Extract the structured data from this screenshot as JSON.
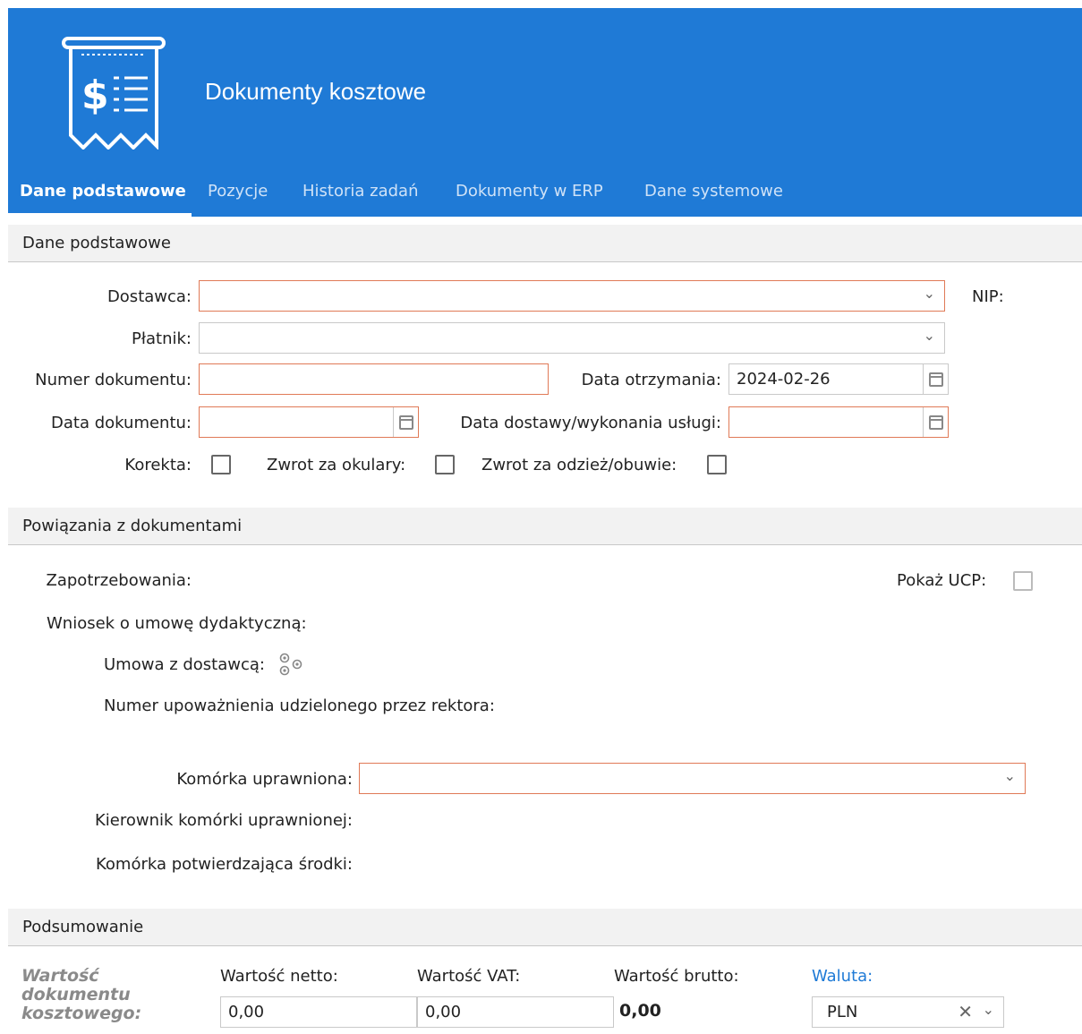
{
  "header": {
    "title": "Dokumenty kosztowe",
    "logo_icon": "receipt-dollar-icon",
    "bg_color": "#1f7ad6"
  },
  "tabs": [
    {
      "label": "Dane podstawowe",
      "active": true
    },
    {
      "label": "Pozycje"
    },
    {
      "label": "Historia zadań"
    },
    {
      "label": "Dokumenty w ERP"
    },
    {
      "label": "Dane systemowe"
    }
  ],
  "sections": {
    "basic": "Dane podstawowe",
    "links": "Powiązania z dokumentami",
    "summary": "Podsumowanie"
  },
  "basic": {
    "dostawca_label": "Dostawca:",
    "dostawca_value": "",
    "nip_label": "NIP:",
    "platnik_label": "Płatnik:",
    "platnik_value": "",
    "numer_label": "Numer dokumentu:",
    "numer_value": "",
    "data_otrzymania_label": "Data otrzymania:",
    "data_otrzymania_value": "2024-02-26",
    "data_dokumentu_label": "Data dokumentu:",
    "data_dokumentu_value": "",
    "data_dostawy_label": "Data dostawy/wykonania usługi:",
    "data_dostawy_value": "",
    "korekta_label": "Korekta:",
    "okulary_label": "Zwrot za okulary:",
    "odziez_label": "Zwrot za odzież/obuwie:"
  },
  "links": {
    "zapotrzebowania_label": "Zapotrzebowania:",
    "pokaz_ucp_label": "Pokaż UCP:",
    "wniosek_label": "Wniosek o umowę dydaktyczną:",
    "umowa_label": "Umowa z dostawcą:",
    "umowa_icon": "gears-icon",
    "numer_upowaznienia_label": "Numer upoważnienia udzielonego przez rektora:",
    "komorka_label": "Komórka uprawniona:",
    "komorka_value": "",
    "kierownik_label": "Kierownik komórki uprawnionej:",
    "komorka_potw_label": "Komórka potwierdzająca środki:"
  },
  "summary": {
    "title_line1": "Wartość",
    "title_line2": "dokumentu",
    "title_line3": "kosztowego:",
    "netto_label": "Wartość netto:",
    "netto_value": "0,00",
    "vat_label": "Wartość VAT:",
    "vat_value": "0,00",
    "brutto_label": "Wartość brutto:",
    "brutto_value": "0,00",
    "waluta_label": "Waluta:",
    "waluta_value": "PLN"
  },
  "colors": {
    "required_border": "#e07a57",
    "accent": "#1f7ad6"
  }
}
